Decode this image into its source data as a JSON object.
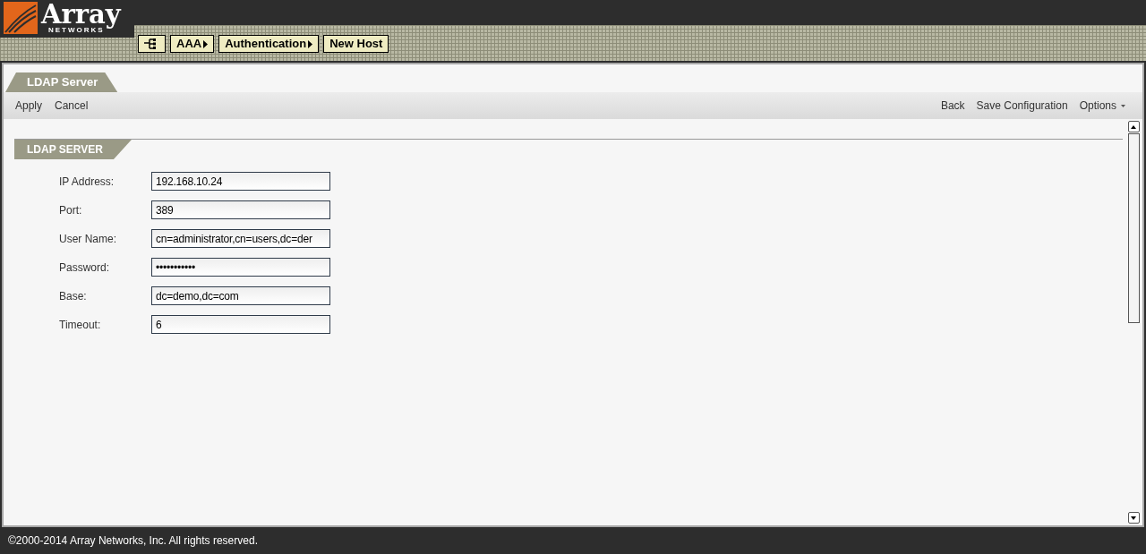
{
  "logo": {
    "name": "Array",
    "sub": "NETWORKS"
  },
  "breadcrumb": [
    {
      "label": "AAA",
      "arrow": true
    },
    {
      "label": "Authentication",
      "arrow": true
    },
    {
      "label": "New Host",
      "arrow": false
    }
  ],
  "page_tab": "LDAP Server",
  "toolbar": {
    "left": [
      "Apply",
      "Cancel"
    ],
    "right": [
      "Back",
      "Save Configuration"
    ],
    "options": "Options"
  },
  "section": "LDAP SERVER",
  "fields": [
    {
      "label": "IP Address:",
      "value": "192.168.10.24"
    },
    {
      "label": "Port:",
      "value": "389"
    },
    {
      "label": "User Name:",
      "value": "cn=administrator,cn=users,dc=der"
    },
    {
      "label": "Password:",
      "value": "•••••••••••"
    },
    {
      "label": "Base:",
      "value": "dc=demo,dc=com"
    },
    {
      "label": "Timeout:",
      "value": "6"
    }
  ],
  "footer": "©2000-2014 Array Networks, Inc. All rights reserved."
}
